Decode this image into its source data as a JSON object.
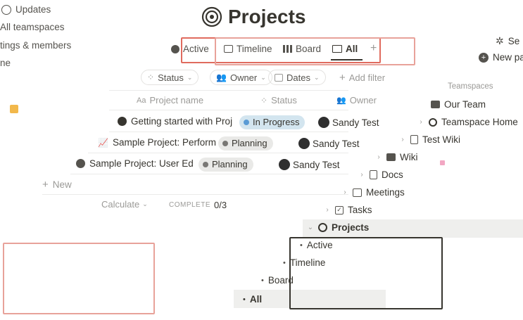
{
  "left_sidebar": {
    "items": [
      {
        "label": "Updates"
      },
      {
        "label": "All teamspaces"
      },
      {
        "label": "tings & members"
      },
      {
        "label": "ne"
      }
    ]
  },
  "page": {
    "title": "Projects"
  },
  "view_tabs": [
    {
      "label": "Active"
    },
    {
      "label": "Timeline"
    },
    {
      "label": "Board"
    },
    {
      "label": "All"
    }
  ],
  "view_tabs_more": "+",
  "right_top": {
    "settings_label": "Se",
    "new_page_label": "New pa"
  },
  "filters": {
    "status": "Status",
    "owner": "Owner",
    "dates": "Dates",
    "add_filter": "Add filter"
  },
  "table": {
    "columns": [
      {
        "label": "Project name",
        "icon": "Aa"
      },
      {
        "label": "Status"
      },
      {
        "label": "Owner"
      }
    ],
    "rows": [
      {
        "name": "Getting started with Proj",
        "status": "In Progress",
        "status_color": "#5a9bd5",
        "owner": "Sandy Test"
      },
      {
        "name": "Sample Project: Perform",
        "status": "Planning",
        "status_color": "#787774",
        "owner": "Sandy Test"
      },
      {
        "name": "Sample Project: User Ed",
        "status": "Planning",
        "status_color": "#787774",
        "owner": "Sandy Test"
      }
    ],
    "new_label": "New",
    "calculate_label": "Calculate",
    "complete_label": "COMPLETE",
    "complete_value": "0/3"
  },
  "teamspaces_sidebar": {
    "header": "Teamspaces",
    "items": [
      {
        "label": "Our Team"
      },
      {
        "label": "Teamspace Home"
      },
      {
        "label": "Test Wiki"
      },
      {
        "label": "Wiki"
      },
      {
        "label": "Docs"
      },
      {
        "label": "Meetings"
      },
      {
        "label": "Tasks"
      },
      {
        "label": "Projects"
      },
      {
        "label": "Active"
      },
      {
        "label": "Timeline"
      },
      {
        "label": "Board"
      },
      {
        "label": "All"
      }
    ]
  },
  "colors": {
    "highlight_box": "#e8a29a",
    "tab_box": "#e06b5e",
    "active_row_bg": "#efefed",
    "in_progress_bg": "#d3e5ef",
    "planning_bg": "#e9e9e7"
  }
}
